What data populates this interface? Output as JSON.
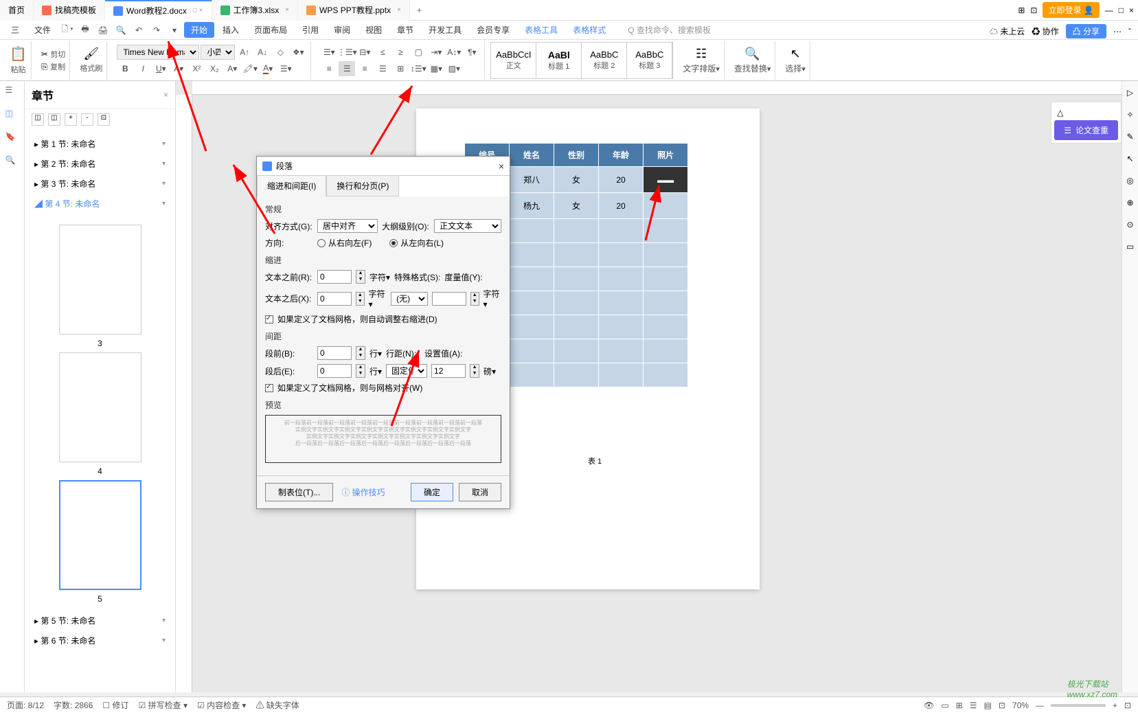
{
  "tabs": {
    "home": "首页",
    "t1": "找稿壳模板",
    "t2": "Word教程2.docx",
    "t3": "工作簿3.xlsx",
    "t4": "WPS PPT教程.pptx"
  },
  "top_right": {
    "login": "立即登录"
  },
  "toolbar": {
    "triple": "三",
    "file": "文件"
  },
  "menu": {
    "start": "开始",
    "insert": "插入",
    "page_layout": "页面布局",
    "reference": "引用",
    "review": "审阅",
    "view": "视图",
    "section": "章节",
    "dev": "开发工具",
    "member": "会员专享",
    "table_tool": "表格工具",
    "table_style": "表格样式",
    "search": "Q 查找命令、搜索模板"
  },
  "tb_right": {
    "cloud": "未上云",
    "coop": "协作",
    "share": "凸 分享"
  },
  "ribbon": {
    "paste": "粘贴",
    "cut": "剪切",
    "copy": "复制",
    "format_painter": "格式刷",
    "font": "Times New Roma",
    "size": "小四",
    "style_body": "正文",
    "style_h1": "标题 1",
    "style_h2": "标题 2",
    "style_h3": "标题 3",
    "text_layout": "文字排版",
    "find_replace": "查找替换",
    "select": "选择"
  },
  "nav": {
    "title": "章节",
    "s1": "第 1 节: 未命名",
    "s2": "第 2 节: 未命名",
    "s3": "第 3 节: 未命名",
    "s4": "第 4 节: 未命名",
    "s5": "第 5 节: 未命名",
    "s6": "第 6 节: 未命名",
    "thumb3": "3",
    "thumb4": "4",
    "thumb5": "5"
  },
  "doc_table": {
    "h1": "编号",
    "h2": "姓名",
    "h3": "性别",
    "h4": "年龄",
    "h5": "照片",
    "r1c2": "郑八",
    "r1c3": "女",
    "r1c4": "20",
    "r2c2": "杨九",
    "r2c3": "女",
    "r2c4": "20",
    "caption": "表 1"
  },
  "dialog": {
    "title": "段落",
    "tab1": "缩进和间距(I)",
    "tab2": "换行和分页(P)",
    "general": "常规",
    "align_label": "对齐方式(G):",
    "align_value": "居中对齐",
    "outline_label": "大纲级别(O):",
    "outline_value": "正文文本",
    "direction": "方向:",
    "rtl": "从右向左(F)",
    "ltr": "从左向右(L)",
    "indent": "缩进",
    "before_text": "文本之前(R):",
    "after_text": "文本之后(X):",
    "char_unit": "字符",
    "special_label": "特殊格式(S):",
    "special_value": "(无)",
    "measure_label": "度量值(Y):",
    "indent_val": "0",
    "auto_indent": "如果定义了文档网格，则自动调整右缩进(D)",
    "spacing": "间距",
    "before_para": "段前(B):",
    "after_para": "段后(E):",
    "line_unit": "行",
    "line_spacing": "行距(N):",
    "line_spacing_value": "固定值",
    "set_value": "设置值(A):",
    "set_value_num": "12",
    "pt_unit": "磅",
    "spacing_val": "0",
    "snap_grid": "如果定义了文档网格，则与网格对齐(W)",
    "preview": "预览",
    "tab_stops": "制表位(T)...",
    "tips": "操作技巧",
    "ok": "确定",
    "cancel": "取消"
  },
  "right_panel": {
    "check": "论文查重"
  },
  "status": {
    "page": "页面: 8/12",
    "words": "字数: 2866",
    "track": "修订",
    "spell": "拼写检查",
    "content": "内容检查",
    "font_missing": "缺失字体",
    "zoom": "70%"
  },
  "watermark": {
    "line1": "极光下载站",
    "line2": "www.xz7.com"
  }
}
